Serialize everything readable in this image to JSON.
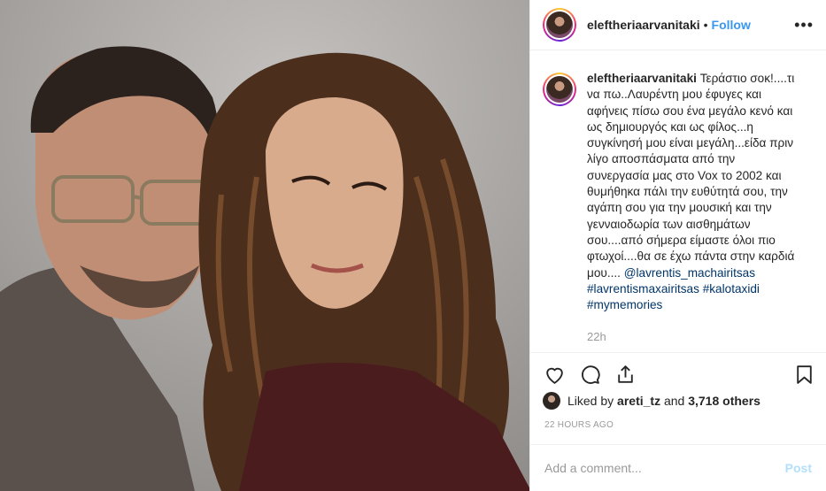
{
  "photo": {
    "alt": ""
  },
  "header": {
    "username": "eleftheriaarvanitaki",
    "separator": "•",
    "follow_label": "Follow",
    "more_label": "•••"
  },
  "caption": {
    "username": "eleftheriaarvanitaki",
    "text": "Τεράστιο σοκ!....τι να πω..Λαυρέντη μου έφυγες και αφήνεις πίσω σου ένα μεγάλο κενό και ως δημιουργός και ως φίλος...η συγκίνησή μου είναι μεγάλη...είδα πριν λίγο αποσπάσματα από την συνεργασία μας στο Vox το 2002 και θυμήθηκα πάλι την ευθύτητά σου, την αγάπη σου για την μουσική και την γενναιοδωρία των αισθημάτων σου....από σήμερα είμαστε όλοι πιο φτωχοί....θα σε έχω πάντα στην καρδιά μου....",
    "mention": "@lavrentis_machairitsas",
    "tags": [
      "#lavrentismaxairitsas",
      "#kalotaxidi",
      "#mymemories"
    ],
    "time": "22h"
  },
  "actions": {
    "like_icon": "heart-icon",
    "comment_icon": "comment-icon",
    "share_icon": "share-icon",
    "save_icon": "bookmark-icon"
  },
  "likes": {
    "prefix": "Liked by",
    "user": "areti_tz",
    "middle": "and",
    "others": "3,718 others"
  },
  "date": "22 HOURS AGO",
  "comment": {
    "placeholder": "Add a comment...",
    "post_label": "Post"
  },
  "colors": {
    "accent": "#3897f0",
    "hashtag": "#003569",
    "muted": "#999999",
    "post_disabled": "#b2dffc"
  }
}
